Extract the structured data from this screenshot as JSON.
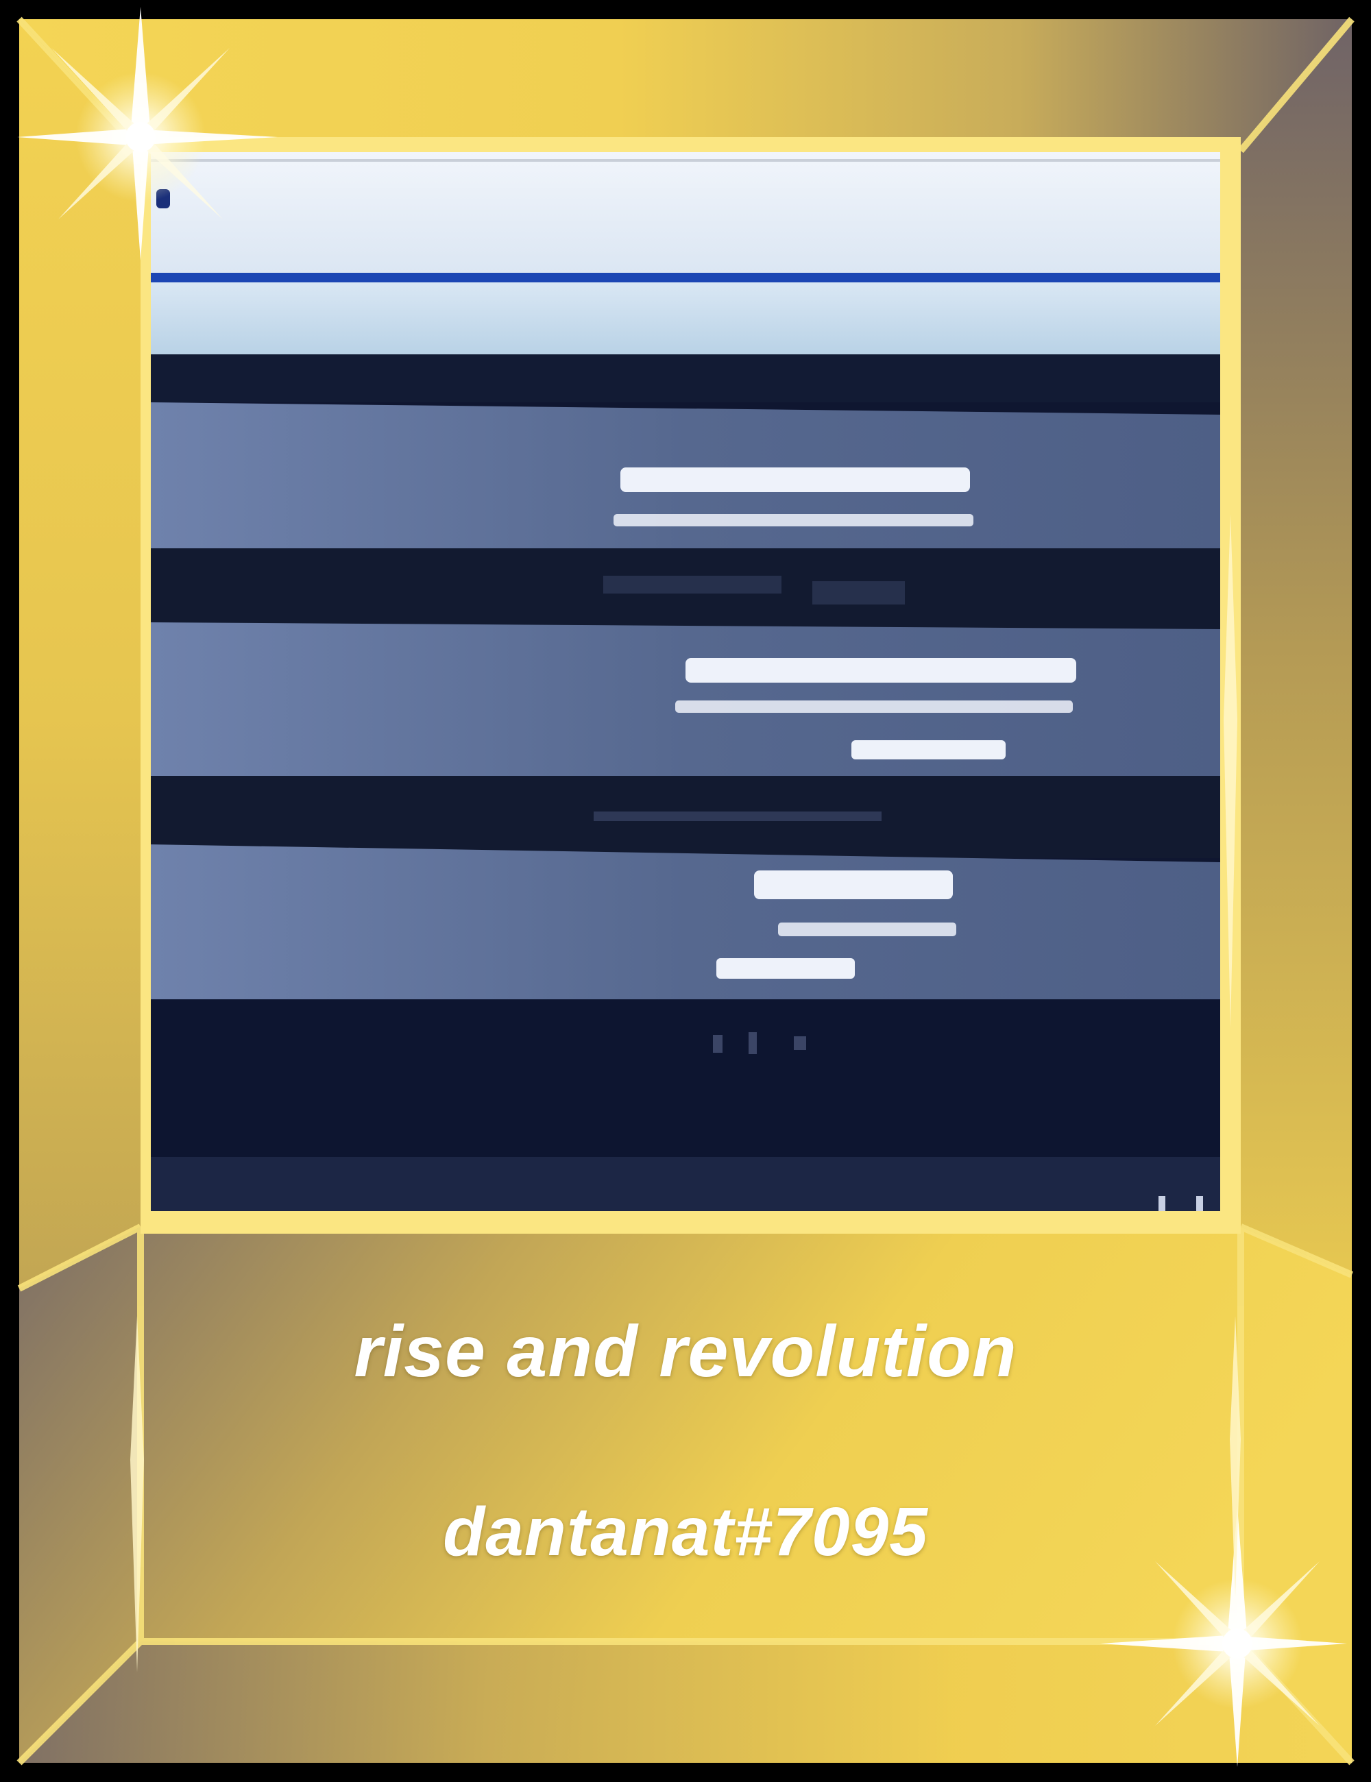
{
  "card": {
    "title": "rise and revolution",
    "handle": "dantanat#7095"
  },
  "colors": {
    "gold_light": "#f2d24e",
    "gold_mid": "#d6b84a",
    "gold_dark": "#7d6e63",
    "background": "#000000",
    "screen_header": "#e3ecf7",
    "screen_accent": "#1c46b4",
    "screen_dark": "#111a33",
    "screen_panel": "#5a6b94",
    "caption_text": "#ffffff"
  }
}
